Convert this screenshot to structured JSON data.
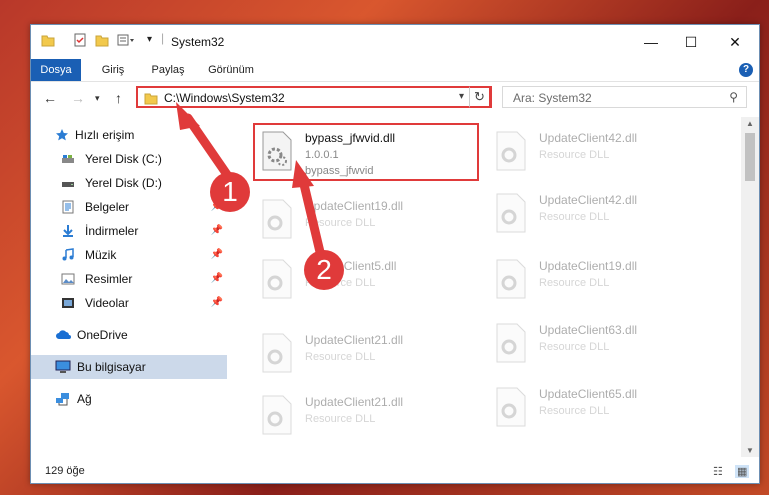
{
  "window": {
    "title": "System32",
    "controls": {
      "minimize": "—",
      "maximize": "☐",
      "close": "✕"
    }
  },
  "ribbon": {
    "tabs": [
      "Dosya",
      "Giriş",
      "Paylaş",
      "Görünüm"
    ],
    "help": "?"
  },
  "nav": {
    "address": "C:\\Windows\\System32",
    "search_placeholder": "Ara: System32"
  },
  "sidebar": {
    "items": [
      {
        "label": "Hızlı erişim",
        "icon": "star-icon"
      },
      {
        "label": "Yerel Disk (C:)",
        "icon": "drive-icon"
      },
      {
        "label": "Yerel Disk (D:)",
        "icon": "drive-icon"
      },
      {
        "label": "Belgeler",
        "icon": "document-icon"
      },
      {
        "label": "İndirmeler",
        "icon": "download-icon"
      },
      {
        "label": "Müzik",
        "icon": "music-icon"
      },
      {
        "label": "Resimler",
        "icon": "pictures-icon"
      },
      {
        "label": "Videolar",
        "icon": "video-icon"
      },
      {
        "label": "OneDrive",
        "icon": "cloud-icon"
      },
      {
        "label": "Bu bilgisayar",
        "icon": "computer-icon"
      },
      {
        "label": "Ağ",
        "icon": "network-icon"
      }
    ],
    "pin": "📌"
  },
  "files": {
    "highlighted": {
      "name": "bypass_jfwvid.dll",
      "version": "1.0.0.1",
      "description": "bypass_jfwvid"
    },
    "left": [
      {
        "name": "UpdateClient19.dll",
        "desc": "Resource DLL"
      },
      {
        "name": "UpdateClient5.dll",
        "desc": "Resource DLL"
      },
      {
        "name": "UpdateClient21.dll",
        "desc": "Resource DLL"
      },
      {
        "name": "UpdateClient21.dll",
        "desc": "Resource DLL"
      }
    ],
    "right": [
      {
        "name": "UpdateClient42.dll",
        "desc": "Resource DLL"
      },
      {
        "name": "UpdateClient42.dll",
        "desc": "Resource DLL"
      },
      {
        "name": "UpdateClient19.dll",
        "desc": "Resource DLL"
      },
      {
        "name": "UpdateClient63.dll",
        "desc": "Resource DLL"
      },
      {
        "name": "UpdateClient65.dll",
        "desc": "Resource DLL"
      }
    ]
  },
  "status": {
    "count": "129 öğe"
  },
  "annotations": {
    "step1": "1",
    "step2": "2"
  },
  "colors": {
    "accent": "#1a5fb4",
    "annotation": "#e03a3a",
    "selected": "#ccd9ea"
  }
}
